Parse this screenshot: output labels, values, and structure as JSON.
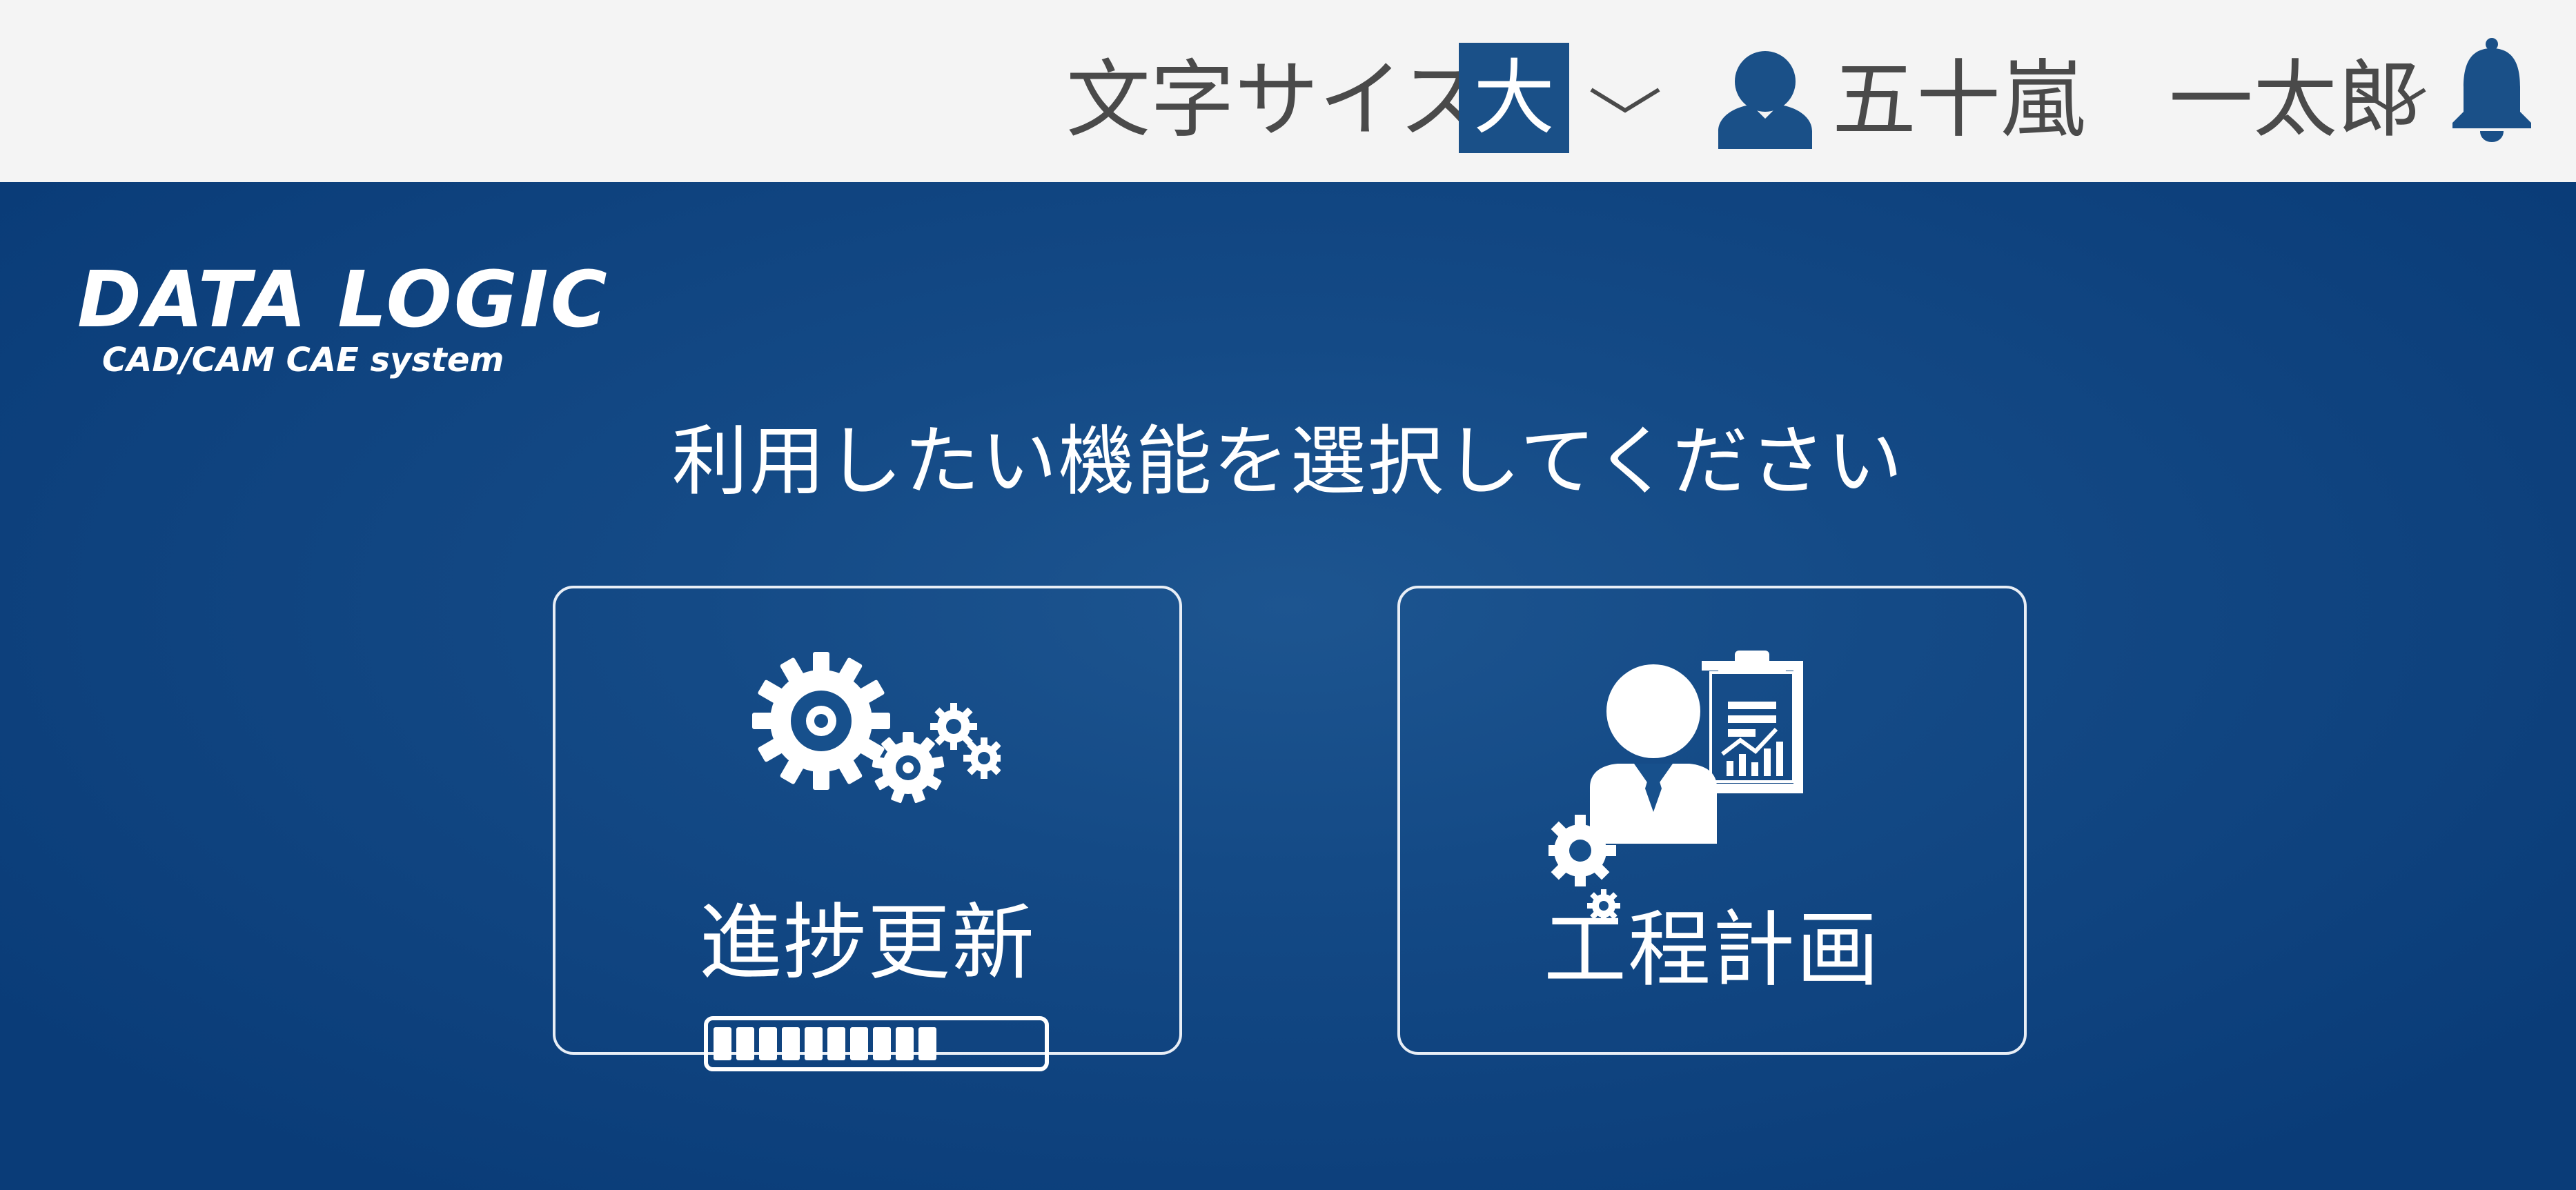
{
  "header": {
    "font_size_label": "文字サイズ",
    "font_size_value": "大",
    "user_name": "五十嵐　一太郎"
  },
  "logo": {
    "title": "DATA LOGIC",
    "subtitle": "CAD/CAM CAE system"
  },
  "main": {
    "prompt": "利用したい機能を選択してください",
    "cards": [
      {
        "label": "進捗更新",
        "icon": "gears-progress-icon",
        "progress_fraction": 0.7
      },
      {
        "label": "工程計画",
        "icon": "businessman-chart-icon"
      }
    ]
  },
  "colors": {
    "header_bg": "#f4f4f4",
    "main_bg": "#0b3d78",
    "accent": "#1a5088",
    "text_dark": "#4a4a4a",
    "text_light": "#ffffff"
  }
}
